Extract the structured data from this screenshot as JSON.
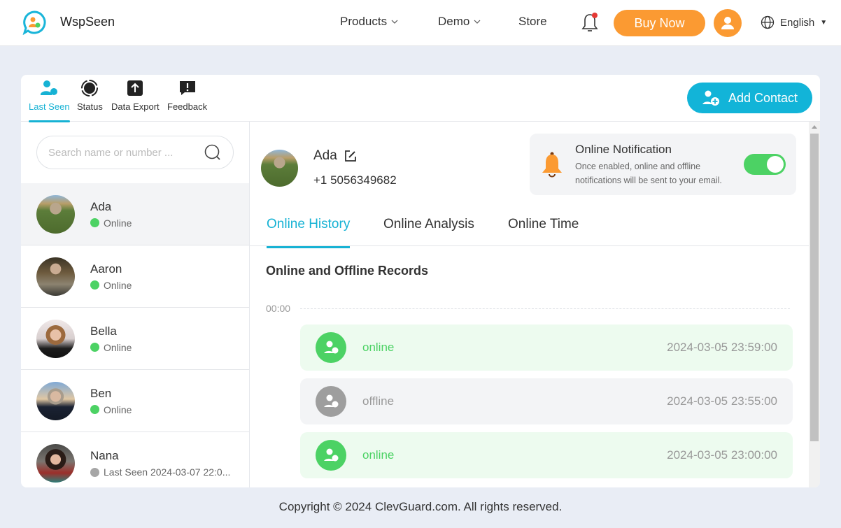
{
  "header": {
    "brand": "WspSeen",
    "nav": [
      {
        "label": "Products",
        "has_dropdown": true
      },
      {
        "label": "Demo",
        "has_dropdown": true
      },
      {
        "label": "Store",
        "has_dropdown": false
      }
    ],
    "buy_now": "Buy Now",
    "language": "English",
    "notification_badge": true,
    "colors": {
      "accent": "#fb9a32",
      "badge": "#e53935"
    }
  },
  "toolbar": {
    "tools": [
      {
        "label": "Last Seen",
        "icon": "users-icon",
        "active": true
      },
      {
        "label": "Status",
        "icon": "status-icon",
        "active": false
      },
      {
        "label": "Data Export",
        "icon": "upload-icon",
        "active": false
      },
      {
        "label": "Feedback",
        "icon": "feedback-icon",
        "active": false
      }
    ],
    "add_contact": "Add Contact",
    "colors": {
      "primary": "#12b4d8"
    }
  },
  "sidebar": {
    "search_placeholder": "Search name or number ...",
    "contacts": [
      {
        "name": "Ada",
        "status": "Online",
        "state": "online",
        "selected": true
      },
      {
        "name": "Aaron",
        "status": "Online",
        "state": "online",
        "selected": false
      },
      {
        "name": "Bella",
        "status": "Online",
        "state": "online",
        "selected": false
      },
      {
        "name": "Ben",
        "status": "Online",
        "state": "online",
        "selected": false
      },
      {
        "name": "Nana",
        "status": "Last Seen 2024-03-07 22:0...",
        "state": "offline",
        "selected": false
      }
    ]
  },
  "detail": {
    "name": "Ada",
    "phone": "+1 5056349682",
    "notification": {
      "title": "Online Notification",
      "description": "Once enabled, online and offline notifications will be sent to your email.",
      "enabled": true
    },
    "tabs": [
      {
        "label": "Online History",
        "active": true
      },
      {
        "label": "Online Analysis",
        "active": false
      },
      {
        "label": "Online Time",
        "active": false
      }
    ],
    "section_title": "Online and Offline Records",
    "time_marker": "00:00",
    "records": [
      {
        "status": "online",
        "time": "2024-03-05 23:59:00"
      },
      {
        "status": "offline",
        "time": "2024-03-05 23:55:00"
      },
      {
        "status": "online",
        "time": "2024-03-05 23:00:00"
      }
    ],
    "colors": {
      "online": "#4cd264",
      "offline": "#9e9e9e"
    }
  },
  "footer": {
    "copyright": "Copyright © 2024 ClevGuard.com. All rights reserved."
  }
}
